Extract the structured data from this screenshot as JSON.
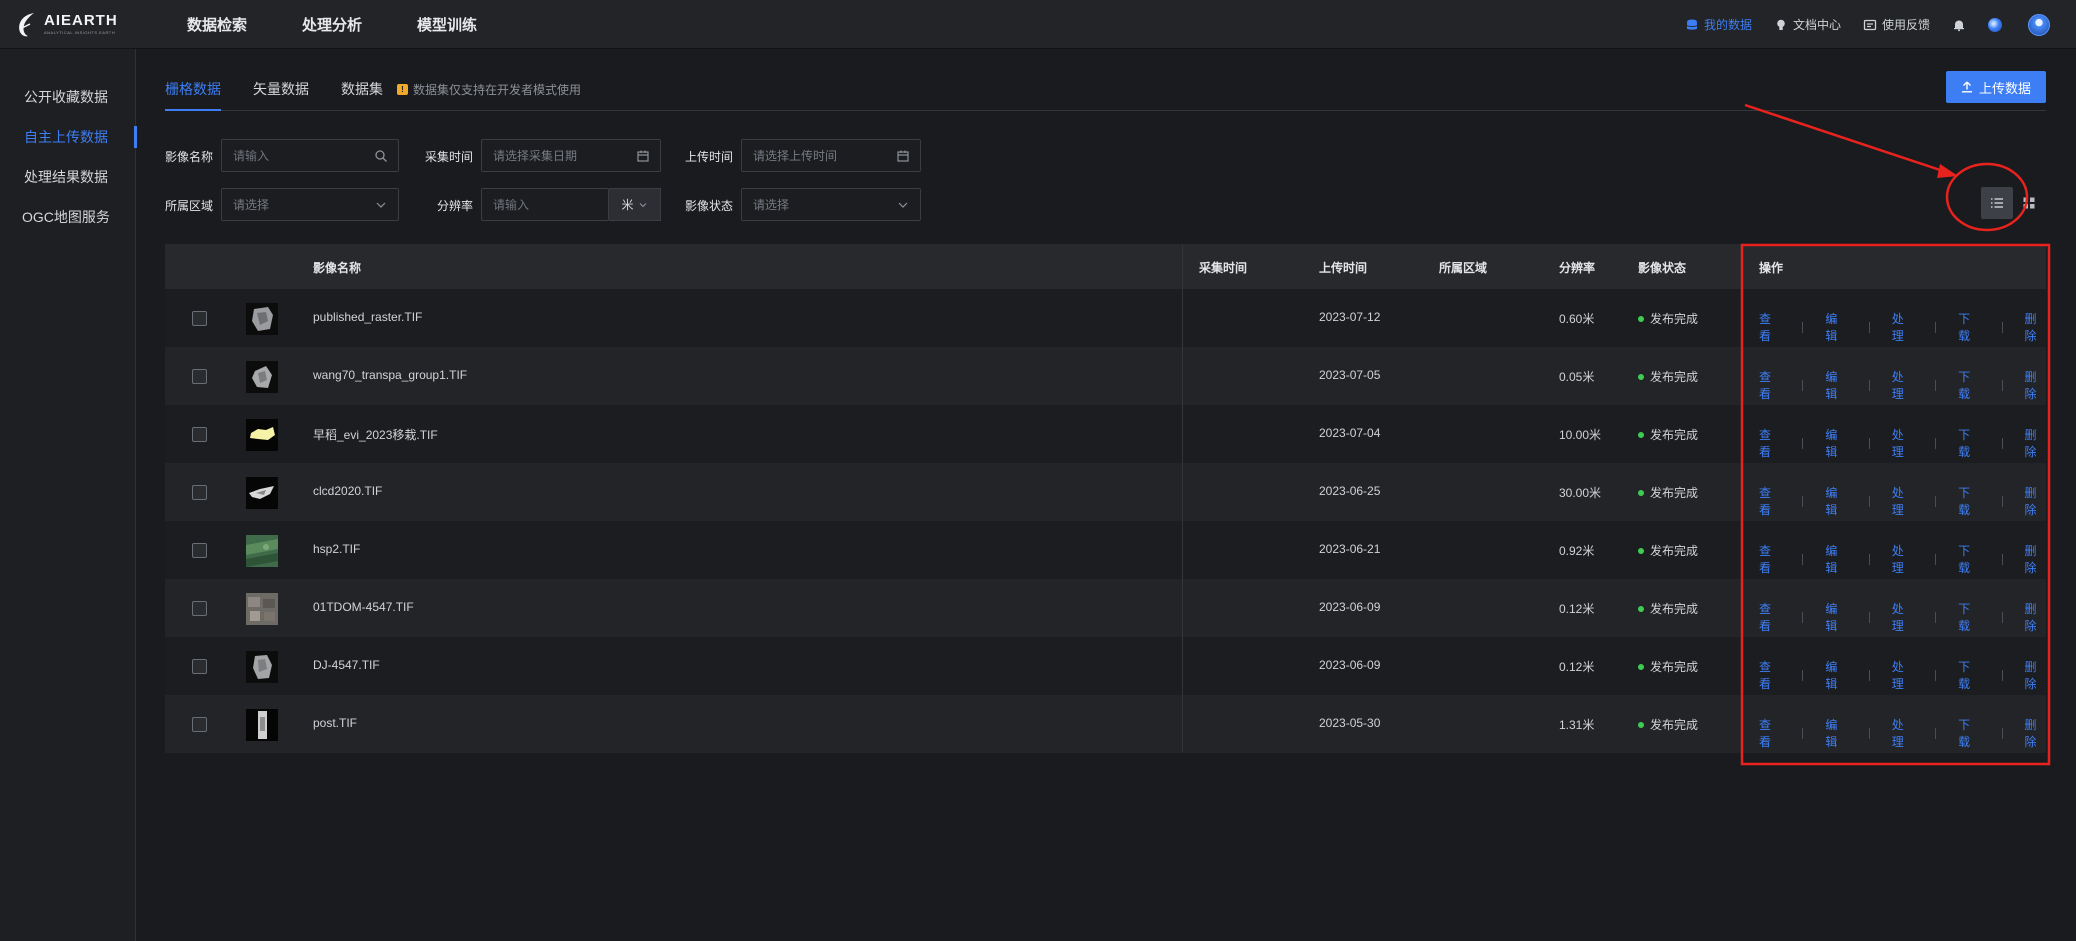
{
  "app": {
    "logo_name": "AIEARTH",
    "logo_sub": "ANALYTICAL INSIGHTS EARTH",
    "nav": [
      "数据检索",
      "处理分析",
      "模型训练"
    ],
    "top_right": [
      "我的数据",
      "文档中心",
      "使用反馈"
    ],
    "icons": [
      "database-icon",
      "bulb-icon",
      "feedback-icon",
      "bell-icon",
      "globe-icon",
      "avatar"
    ]
  },
  "sidebar": {
    "items": [
      "公开收藏数据",
      "自主上传数据",
      "处理结果数据",
      "OGC地图服务"
    ],
    "active": 1
  },
  "tabs": {
    "items": [
      "栅格数据",
      "矢量数据",
      "数据集"
    ],
    "hint": "数据集仅支持在开发者模式使用",
    "active": 0
  },
  "upload_label": "上传数据",
  "filters": {
    "name_label": "影像名称",
    "name_placeholder": "请输入",
    "collect_label": "采集时间",
    "collect_placeholder": "请选择采集日期",
    "upload_label": "上传时间",
    "upload_placeholder": "请选择上传时间",
    "region_label": "所属区域",
    "region_placeholder": "请选择",
    "resolution_label": "分辨率",
    "resolution_placeholder": "请输入",
    "unit": "米",
    "status_label": "影像状态",
    "status_placeholder": "请选择"
  },
  "view_mode": "list",
  "table": {
    "headers": [
      "影像名称",
      "采集时间",
      "上传时间",
      "所属区域",
      "分辨率",
      "影像状态",
      "操作"
    ],
    "ops": [
      "查看",
      "编辑",
      "处理",
      "下载",
      "删除"
    ],
    "rows": [
      {
        "name": "published_raster.TIF",
        "collect": "",
        "upload": "2023-07-12",
        "region": "",
        "res": "0.60米",
        "status": "发布完成"
      },
      {
        "name": "wang70_transpa_group1.TIF",
        "collect": "",
        "upload": "2023-07-05",
        "region": "",
        "res": "0.05米",
        "status": "发布完成"
      },
      {
        "name": "早稻_evi_2023移栽.TIF",
        "collect": "",
        "upload": "2023-07-04",
        "region": "",
        "res": "10.00米",
        "status": "发布完成"
      },
      {
        "name": "clcd2020.TIF",
        "collect": "",
        "upload": "2023-06-25",
        "region": "",
        "res": "30.00米",
        "status": "发布完成"
      },
      {
        "name": "hsp2.TIF",
        "collect": "",
        "upload": "2023-06-21",
        "region": "",
        "res": "0.92米",
        "status": "发布完成"
      },
      {
        "name": "01TDOM-4547.TIF",
        "collect": "",
        "upload": "2023-06-09",
        "region": "",
        "res": "0.12米",
        "status": "发布完成"
      },
      {
        "name": "DJ-4547.TIF",
        "collect": "",
        "upload": "2023-06-09",
        "region": "",
        "res": "0.12米",
        "status": "发布完成"
      },
      {
        "name": "post.TIF",
        "collect": "",
        "upload": "2023-05-30",
        "region": "",
        "res": "1.31米",
        "status": "发布完成"
      }
    ]
  },
  "colors": {
    "accent": "#3d7ef5",
    "status_ok": "#3fcc52",
    "annotation": "#e8231d"
  }
}
